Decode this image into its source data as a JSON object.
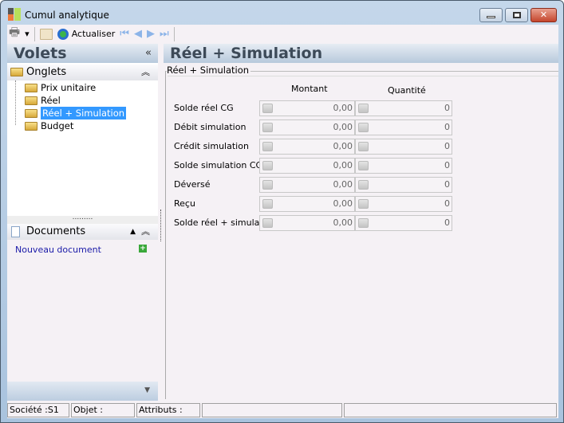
{
  "window": {
    "title": "Cumul analytique"
  },
  "toolbar": {
    "refresh_label": "Actualiser"
  },
  "left_panel": {
    "title": "Volets",
    "tabs_section": "Onglets",
    "tree": [
      {
        "label": "Prix unitaire"
      },
      {
        "label": "Réel"
      },
      {
        "label": "Réel + Simulation",
        "selected": true
      },
      {
        "label": "Budget"
      }
    ],
    "documents_section": "Documents",
    "new_document": "Nouveau document"
  },
  "main": {
    "title": "Réel + Simulation",
    "group_label": "Réel + Simulation",
    "columns": [
      "Montant",
      "Quantité"
    ],
    "rows": [
      {
        "label": "Solde réel CG",
        "montant": "0,00",
        "quantite": "0"
      },
      {
        "label": "Débit simulation",
        "montant": "0,00",
        "quantite": "0"
      },
      {
        "label": "Crédit simulation",
        "montant": "0,00",
        "quantite": "0"
      },
      {
        "label": "Solde simulation CG",
        "montant": "0,00",
        "quantite": "0"
      },
      {
        "label": "Déversé",
        "montant": "0,00",
        "quantite": "0"
      },
      {
        "label": "Reçu",
        "montant": "0,00",
        "quantite": "0"
      },
      {
        "label": "Solde réel + simulation",
        "montant": "0,00",
        "quantite": "0"
      }
    ]
  },
  "status": {
    "societe": "Société :S1",
    "objet": "Objet :",
    "attributs": "Attributs :"
  }
}
